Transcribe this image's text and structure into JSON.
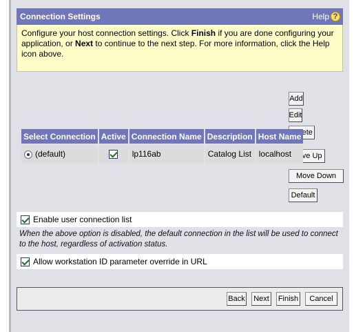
{
  "header": {
    "title": "Connection Settings",
    "help_label": "Help",
    "help_icon": "question-icon"
  },
  "info": {
    "text_1": "Configure your host connection settings. Click ",
    "finish_word": "Finish",
    "text_2": " if you are done configuring your application, or ",
    "next_word": "Next",
    "text_3": " to continue to the next step. For more information, click the Help icon above."
  },
  "side_buttons": {
    "add": "Add",
    "edit": "Edit",
    "delete": "Delete",
    "move_up": "Move Up",
    "move_down": "Move Down",
    "default": "Default"
  },
  "table": {
    "columns": [
      "Select Connection",
      "Active",
      "Connection Name",
      "Description",
      "Host Name"
    ],
    "rows": [
      {
        "select": "(default)",
        "selected": true,
        "active": true,
        "name": "lp116ab",
        "description": "Catalog List",
        "host": "localhost"
      }
    ]
  },
  "options": {
    "enable_user_list": {
      "label": "Enable user connection list",
      "checked": true
    },
    "note": "When the above option is disabled, the default connection in the list will be used to connect to the host, regardless of activation status.",
    "allow_workstation": {
      "label": "Allow workstation ID parameter override in URL",
      "checked": true
    }
  },
  "footer": {
    "back": "Back",
    "next": "Next",
    "finish": "Finish",
    "cancel": "Cancel"
  },
  "colors": {
    "header_bg": "#7176b8",
    "info_bg": "#fffdc8",
    "panel_bg": "#e0e0e7"
  }
}
